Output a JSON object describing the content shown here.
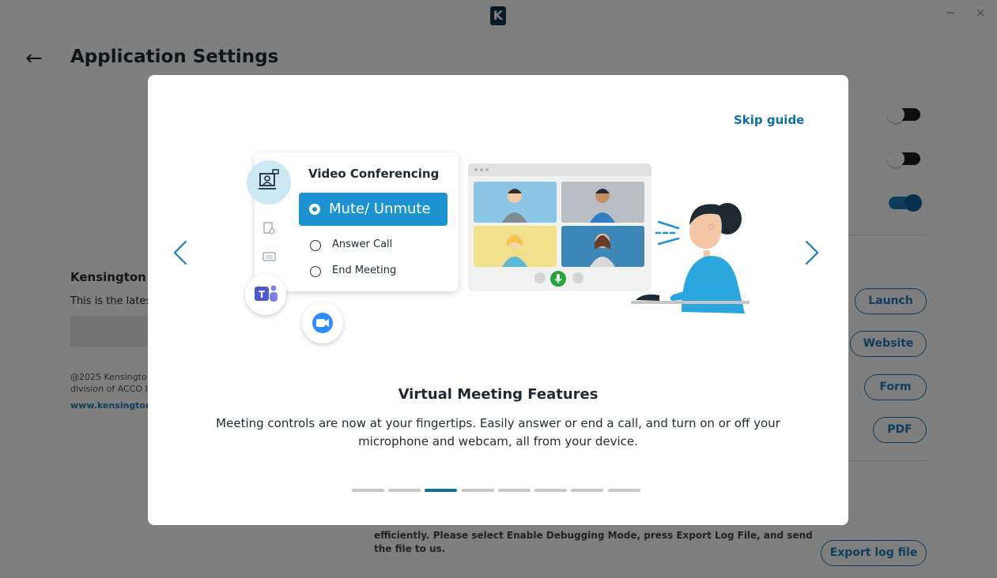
{
  "window": {
    "logo_letter": "K",
    "minimize_glyph": "−",
    "close_glyph": "×"
  },
  "page": {
    "title": "Application Settings",
    "back_glyph": "←"
  },
  "settings": {
    "toggles": [
      {
        "state": "off"
      },
      {
        "state": "off"
      },
      {
        "state": "on"
      }
    ],
    "product_heading": "Kensington K",
    "product_status": "This is the lates",
    "copyright": "@2025 Kensingto\ndivision of ACCO I",
    "website_link": "www.kensington.",
    "buttons": {
      "launch": "Launch",
      "website": "Website",
      "form": "Form",
      "pdf": "PDF",
      "export": "Export log file"
    },
    "debug_text": "efficiently. Please select Enable Debugging Mode, press Export Log File, and send the file to us."
  },
  "guide": {
    "skip_label": "Skip guide",
    "card": {
      "title": "Video Conferencing",
      "selected_option": "Mute/ Unmute",
      "options": [
        "Answer Call",
        "End Meeting"
      ]
    },
    "slide_title": "Virtual Meeting Features",
    "slide_body": "Meeting controls are now at your fingertips. Easily answer or end a call, and turn on or off your microphone and webcam, all from your device.",
    "pagination": {
      "total": 8,
      "active_index": 2
    }
  },
  "colors": {
    "accent": "#0e6fa3",
    "button_blue": "#1f93cf",
    "toggle_on": "#1a7bb8",
    "overlay": "rgba(0,0,0,0.5)"
  }
}
